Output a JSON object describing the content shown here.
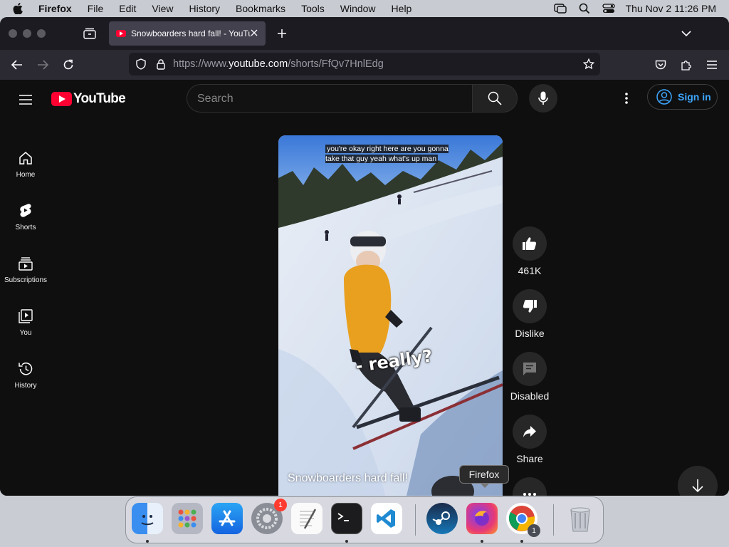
{
  "menubar": {
    "app_name": "Firefox",
    "menus": [
      "File",
      "Edit",
      "View",
      "History",
      "Bookmarks",
      "Tools",
      "Window",
      "Help"
    ],
    "clock": "Thu Nov 2  11:26 PM"
  },
  "browser": {
    "tab_title": "Snowboarders hard fall! - YouTube",
    "url_prefix": "https://www.",
    "url_domain": "youtube.com",
    "url_path": "/shorts/FfQv7HnlEdg"
  },
  "youtube": {
    "logo_text": "YouTube",
    "search_placeholder": "Search",
    "sign_in": "Sign in",
    "sidebar": [
      {
        "label": "Home",
        "icon": "home-icon"
      },
      {
        "label": "Shorts",
        "icon": "shorts-icon"
      },
      {
        "label": "Subscriptions",
        "icon": "subscriptions-icon"
      },
      {
        "label": "You",
        "icon": "you-icon"
      },
      {
        "label": "History",
        "icon": "history-icon"
      }
    ],
    "video": {
      "caption": "you're okay right here are you gonna take that guy yeah what's up man",
      "subtitle_overlay": "- really?",
      "title": "Snowboarders hard fall!"
    },
    "actions": {
      "like_count": "461K",
      "dislike": "Dislike",
      "comments": "Disabled",
      "share": "Share"
    }
  },
  "dock": {
    "tooltip": "Firefox",
    "apps": [
      "Finder",
      "Launchpad",
      "App Store",
      "System Settings",
      "TextEdit",
      "Terminal",
      "Visual Studio Code",
      "Steam",
      "Firefox",
      "Google Chrome",
      "Trash"
    ],
    "settings_badge": "1",
    "chrome_badge": "1"
  },
  "colors": {
    "youtube_red": "#ff0033",
    "signin_blue": "#3ea6ff",
    "page_bg": "#0f0f0f"
  }
}
